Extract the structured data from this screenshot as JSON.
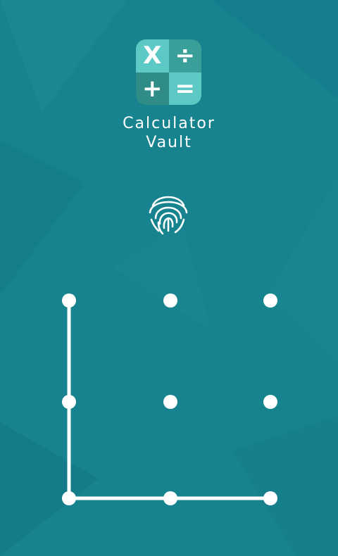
{
  "app": {
    "title_line1": "Calculator",
    "title_line2": "Vault"
  },
  "logo": {
    "symbols": [
      "X",
      "÷",
      "+",
      "="
    ]
  },
  "icons": {
    "fingerprint": "fingerprint-icon"
  },
  "pattern": {
    "grid": "3x3",
    "selected_sequence": [
      1,
      4,
      7,
      8,
      9
    ]
  },
  "colors": {
    "background": "#17838f",
    "logo_light": "#5cc9c4",
    "logo_dark": "#2f8c86",
    "pattern": "#ffffff"
  }
}
